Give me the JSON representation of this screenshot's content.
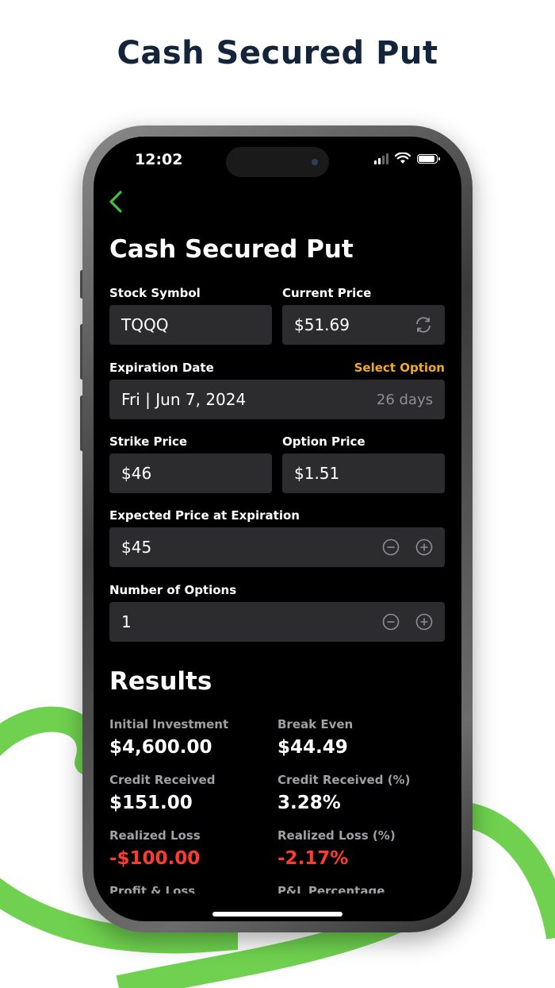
{
  "promo": {
    "headline": "Cash Secured Put"
  },
  "status_bar": {
    "time": "12:02"
  },
  "nav": {
    "back_icon": "chevron-left-icon",
    "accent_color": "#3ec43e"
  },
  "screen": {
    "title": "Cash Secured Put"
  },
  "form": {
    "stock_symbol": {
      "label": "Stock Symbol",
      "value": "TQQQ"
    },
    "current_price": {
      "label": "Current Price",
      "value": "$51.69",
      "icon": "refresh-icon"
    },
    "expiration_date": {
      "label": "Expiration Date",
      "select_option": "Select Option",
      "value": "Fri | Jun 7, 2024",
      "days": "26 days"
    },
    "strike_price": {
      "label": "Strike Price",
      "value": "$46"
    },
    "option_price": {
      "label": "Option Price",
      "value": "$1.51"
    },
    "expected_price": {
      "label": "Expected Price at Expiration",
      "value": "$45"
    },
    "number_of_options": {
      "label": "Number of Options",
      "value": "1"
    }
  },
  "results": {
    "title": "Results",
    "items": [
      {
        "label": "Initial Investment",
        "value": "$4,600.00"
      },
      {
        "label": "Break Even",
        "value": "$44.49"
      },
      {
        "label": "Credit Received",
        "value": "$151.00"
      },
      {
        "label": "Credit Received (%)",
        "value": "3.28%"
      },
      {
        "label": "Realized Loss",
        "value": "-$100.00"
      },
      {
        "label": "Realized Loss (%)",
        "value": "-2.17%"
      },
      {
        "label": "Profit & Loss",
        "value": ""
      },
      {
        "label": "P&L Percentage",
        "value": ""
      }
    ]
  },
  "colors": {
    "accent_orange": "#f0a92a",
    "negative_red": "#ff3b30",
    "brand_green": "#6fd14f",
    "headline_navy": "#14243b"
  }
}
